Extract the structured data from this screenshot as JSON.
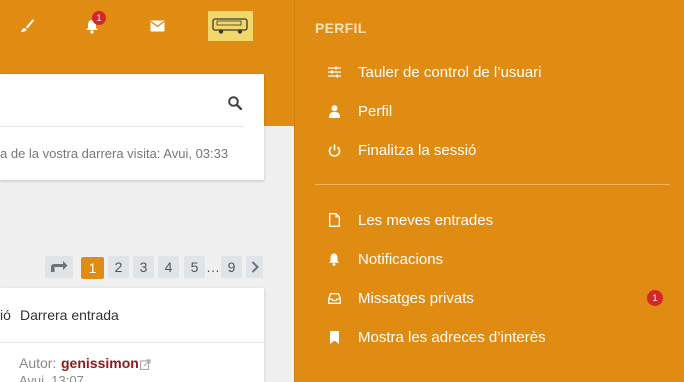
{
  "header": {
    "notifications_badge": "1"
  },
  "search": {
    "placeholder": ""
  },
  "visit_text": "a de la vostra darrera visita: Avui, 03:33",
  "pagination": [
    "1",
    "2",
    "3",
    "4",
    "5",
    "…",
    "9"
  ],
  "list": {
    "col_left": "ió",
    "col_last_post": "Darrera entrada",
    "author_label": "Autor:",
    "author_name": "genissimon",
    "date": "Avui, 13:07"
  },
  "panel": {
    "title": "PERFIL",
    "items": [
      {
        "label": "Tauler de control de l’usuari",
        "icon": "sliders-icon"
      },
      {
        "label": "Perfil",
        "icon": "user-icon"
      },
      {
        "label": "Finalitza la sessió",
        "icon": "power-icon"
      }
    ],
    "items2": [
      {
        "label": "Les meves entrades",
        "icon": "file-icon"
      },
      {
        "label": "Notificacions",
        "icon": "bell-icon"
      },
      {
        "label": "Missatges privats",
        "icon": "inbox-icon",
        "badge": "1"
      },
      {
        "label": "Mostra les adreces d’interès",
        "icon": "bookmark-icon"
      }
    ]
  },
  "colors": {
    "accent": "#e08b12",
    "badge": "#d6262b",
    "author": "#8b1a1a"
  }
}
